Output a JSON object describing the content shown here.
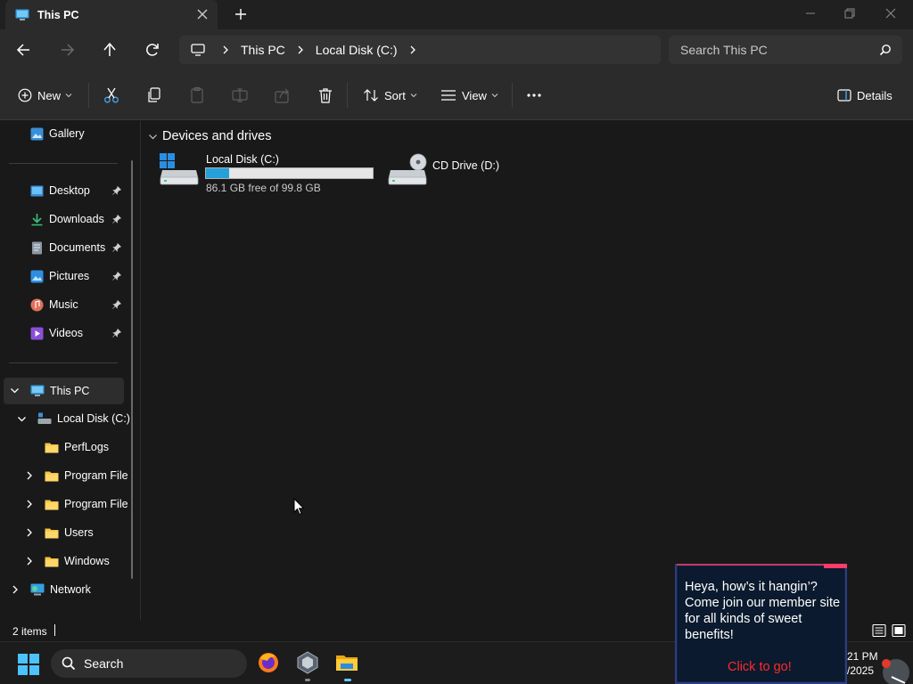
{
  "window": {
    "tab_title": "This PC",
    "colors": {
      "accent": "#26a0da",
      "background": "#191919",
      "chrome": "#2b2b2b"
    }
  },
  "address": {
    "crumbs": [
      "This PC",
      "Local Disk (C:)"
    ],
    "search_placeholder": "Search This PC"
  },
  "commands": {
    "new": "New",
    "sort": "Sort",
    "view": "View",
    "details": "Details"
  },
  "sidebar": {
    "gallery": "Gallery",
    "quick": [
      "Desktop",
      "Downloads",
      "Documents",
      "Pictures",
      "Music",
      "Videos"
    ],
    "this_pc": "This PC",
    "local_disk": "Local Disk (C:)",
    "folders": [
      "PerfLogs",
      "Program File",
      "Program File",
      "Users",
      "Windows"
    ],
    "network": "Network"
  },
  "main": {
    "group_title": "Devices and drives",
    "drives": [
      {
        "name": "Local Disk (C:)",
        "space": "86.1 GB free of 99.8 GB",
        "used_fraction": 0.137
      },
      {
        "name": "CD Drive (D:)"
      }
    ]
  },
  "status": {
    "items": "2 items"
  },
  "taskbar": {
    "search_label": "Search",
    "clock_time": "21 PM",
    "clock_date": "/2025"
  },
  "popup": {
    "message": "Heya, how’s it hangin’? Come join our member site for all kinds of sweet benefits!",
    "link": "Click to go!"
  }
}
